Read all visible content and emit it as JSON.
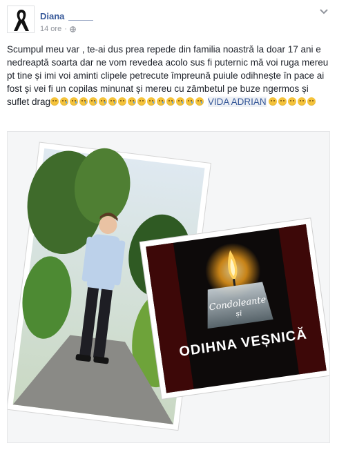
{
  "post": {
    "author": "Diana",
    "time": "14 ore",
    "separator": "·",
    "text_main": "Scumpul meu var , te-ai dus prea repede din familia noastră la doar 17 ani e nedreaptă soarta dar ne vom revedea acolo sus fi puternic mă voi ruga mereu pt tine și imi voi aminti clipele petrecute împreună puiule odihnește în pace ai fost și vei fi un copilas minunat și mereu cu zâmbetul pe buze ngermos și suflet drag",
    "mention": "VIDA ADRIAN",
    "icons": {
      "avatar": "black-mourning-ribbon",
      "privacy": "globe-icon",
      "options": "chevron-down-icon",
      "emoji_a": "disappointed-relieved-face",
      "emoji_b": "pensive-face"
    }
  },
  "image": {
    "right_card_line1": "Condoleante",
    "right_card_line2": "și",
    "right_card_line3": "ODIHNA VEȘNICĂ"
  },
  "colors": {
    "link": "#365899",
    "meta": "#90949c",
    "text": "#1d2129",
    "flame": "#f7a21b"
  }
}
